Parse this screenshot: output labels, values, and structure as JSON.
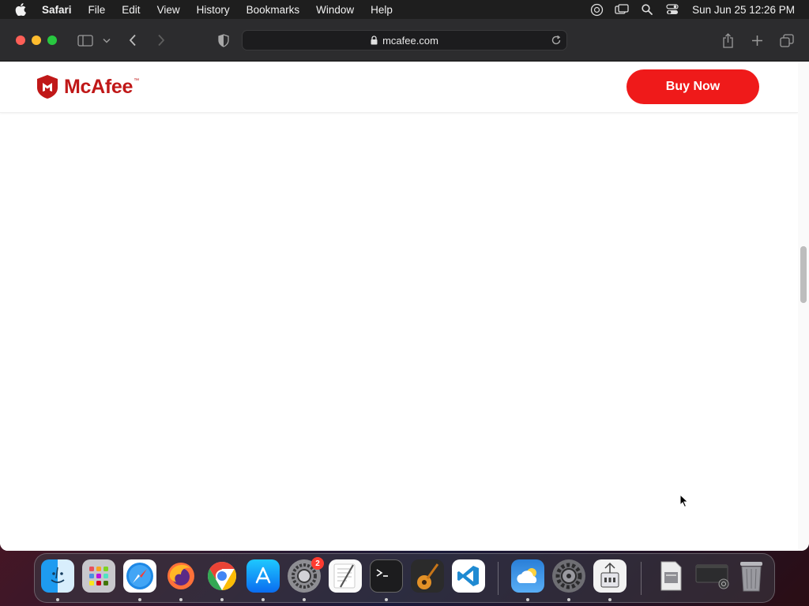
{
  "menubar": {
    "app_name": "Safari",
    "items": [
      "File",
      "Edit",
      "View",
      "History",
      "Bookmarks",
      "Window",
      "Help"
    ],
    "clock": "Sun Jun 25  12:26 PM"
  },
  "browser": {
    "url": "mcafee.com"
  },
  "page": {
    "brand": "McAfee",
    "trademark": "™",
    "buy_button": "Buy Now"
  },
  "dock": {
    "apps": [
      "finder",
      "launchpad",
      "safari",
      "firefox",
      "chrome",
      "app-store",
      "system-preferences",
      "textedit",
      "terminal",
      "garageband",
      "vscode",
      "weather",
      "settings",
      "archive-utility",
      "preview",
      "screenshot",
      "trash"
    ],
    "system_preferences_badge": "2"
  },
  "colors": {
    "brand_red": "#c01818",
    "button_red": "#ef1a1a"
  }
}
